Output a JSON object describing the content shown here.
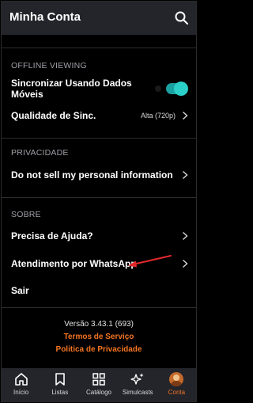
{
  "header": {
    "title": "Minha Conta"
  },
  "sections": {
    "offline": {
      "label": "OFFLINE VIEWING",
      "sync_label": "Sincronizar Usando Dados Móveis",
      "quality_label": "Qualidade de Sinc.",
      "quality_value": "Alta (720p)"
    },
    "privacy": {
      "label": "PRIVACIDADE",
      "dnsmpi_label": "Do not sell my personal information"
    },
    "about": {
      "label": "SOBRE",
      "help_label": "Precisa de Ajuda?",
      "whatsapp_label": "Atendimento por WhatsApp",
      "logout_label": "Sair"
    }
  },
  "footer": {
    "version": "Versão 3.43.1 (693)",
    "terms": "Termos de Serviço",
    "privacy_policy": "Politica de Privacidade"
  },
  "tabs": [
    {
      "label": "Início",
      "icon": "home-icon"
    },
    {
      "label": "Listas",
      "icon": "bookmark-icon"
    },
    {
      "label": "Catálogo",
      "icon": "grid-icon"
    },
    {
      "label": "Simulcasts",
      "icon": "sparkle-icon"
    },
    {
      "label": "Conta",
      "icon": "avatar-icon",
      "active": true
    }
  ],
  "colors": {
    "accent": "#f47521",
    "toggle": "#2bd0c9",
    "bar": "#23252b"
  }
}
